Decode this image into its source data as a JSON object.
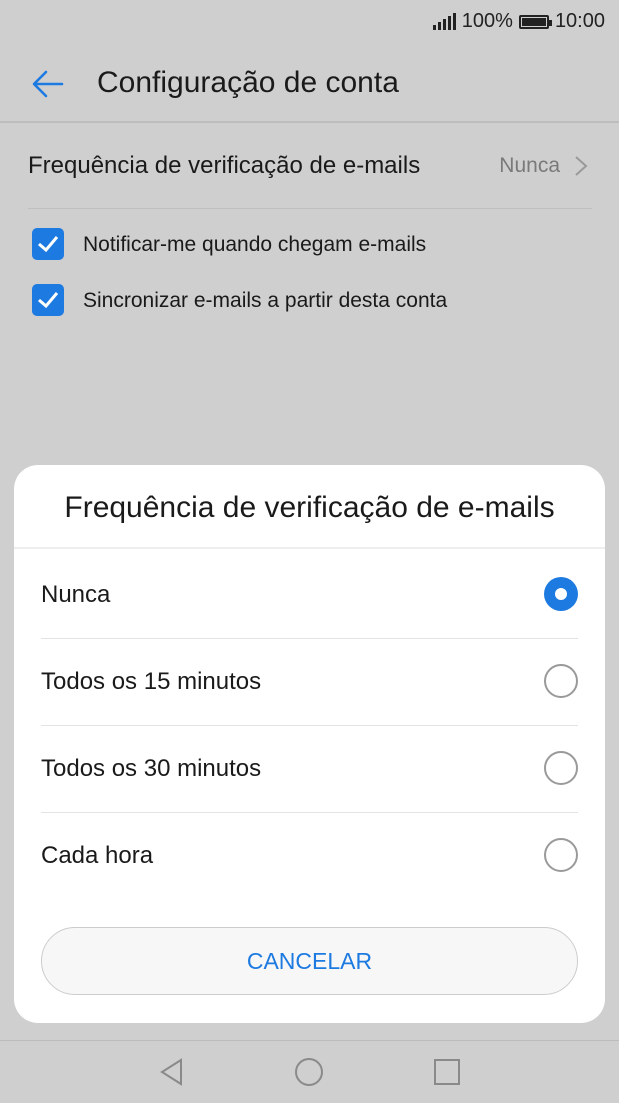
{
  "status": {
    "battery_pct": "100%",
    "time": "10:00",
    "battery_level": 1.0
  },
  "header": {
    "title": "Configuração de conta"
  },
  "settings": {
    "frequency": {
      "label": "Frequência de verificação de e-mails",
      "value": "Nunca"
    },
    "checkboxes": [
      {
        "label": "Notificar-me quando chegam e-mails",
        "checked": true
      },
      {
        "label": "Sincronizar e-mails a partir desta conta",
        "checked": true
      }
    ]
  },
  "dialog": {
    "title": "Frequência de verificação de e-mails",
    "options": [
      {
        "label": "Nunca",
        "selected": true
      },
      {
        "label": "Todos os 15 minutos",
        "selected": false
      },
      {
        "label": "Todos os 30 minutos",
        "selected": false
      },
      {
        "label": "Cada hora",
        "selected": false
      }
    ],
    "cancel_label": "CANCELAR"
  },
  "colors": {
    "accent": "#1d7ae0",
    "overlay": "#cfcfcf"
  },
  "icons": [
    "signal-icon",
    "battery-icon",
    "back-arrow-icon",
    "chevron-right-icon",
    "check-icon",
    "nav-back-icon",
    "nav-home-icon",
    "nav-recents-icon"
  ]
}
